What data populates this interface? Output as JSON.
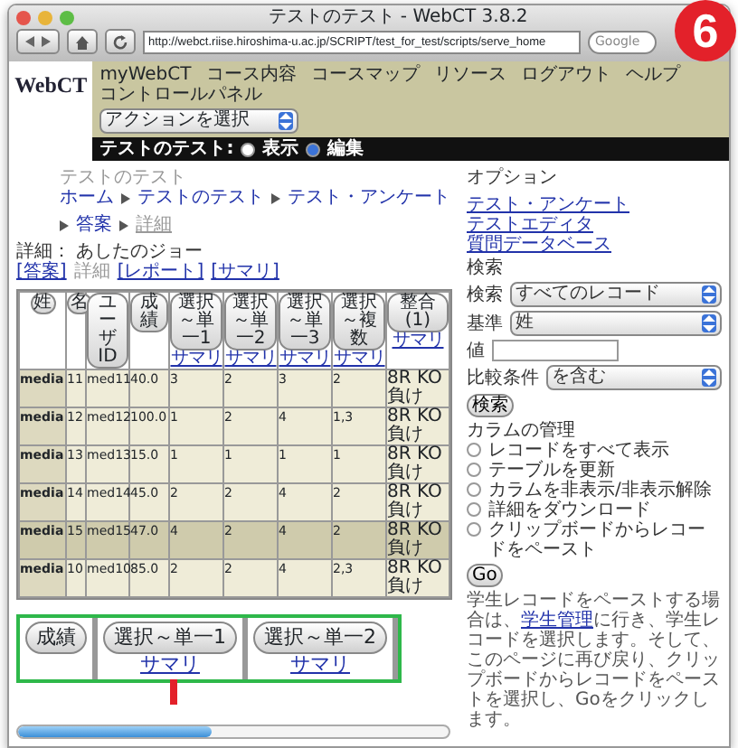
{
  "window": {
    "title": "テストのテスト - WebCT 3.8.2"
  },
  "toolbar": {
    "url": "http://webct.riise.hiroshima-u.ac.jp/SCRIPT/test_for_test/scripts/serve_home",
    "search": {
      "placeholder": "Google"
    }
  },
  "logo": "WebCT",
  "nav_links": [
    "myWebCT",
    "コース内容",
    "コースマップ",
    "リソース",
    "ログアウト",
    "ヘルプ",
    "コントロールパネル"
  ],
  "action_select": "アクションを選択",
  "mode_bar": {
    "label": "テストのテスト:",
    "options": [
      {
        "label": "表示",
        "selected": false
      },
      {
        "label": "編集",
        "selected": true
      }
    ]
  },
  "course_title": "テストのテスト",
  "breadcrumb": [
    {
      "label": "ホーム",
      "current": false
    },
    {
      "label": "テストのテスト",
      "current": false
    },
    {
      "label": "テスト・アンケート",
      "current": false
    },
    {
      "label": "答案",
      "current": false
    },
    {
      "label": "詳細",
      "current": true
    }
  ],
  "detail_heading": "詳細： あしたのジョー",
  "view_links": [
    {
      "label": "[答案]",
      "disabled": false
    },
    {
      "label": "詳細",
      "disabled": true
    },
    {
      "label": "[レポート]",
      "disabled": false
    },
    {
      "label": "[サマリ]",
      "disabled": false
    }
  ],
  "table": {
    "columns": [
      {
        "label": "姓"
      },
      {
        "label": "名"
      },
      {
        "label": "ユーザID"
      },
      {
        "label": "成績"
      },
      {
        "label": "選択～単一1",
        "link": "サマリ"
      },
      {
        "label": "選択～単一2",
        "link": "サマリ"
      },
      {
        "label": "選択～単一3",
        "link": "サマリ"
      },
      {
        "label": "選択～複数",
        "link": "サマリ"
      },
      {
        "label": "整合 (1)",
        "link": "サマリ"
      }
    ],
    "rows": [
      {
        "selected": false,
        "cells": [
          "media",
          "11",
          "med11",
          "40.0",
          "3",
          "2",
          "3",
          "2",
          "8R KO負け"
        ]
      },
      {
        "selected": false,
        "cells": [
          "media",
          "12",
          "med12",
          "100.0",
          "1",
          "2",
          "4",
          "1,3",
          "8R KO負け"
        ]
      },
      {
        "selected": false,
        "cells": [
          "media",
          "13",
          "med13",
          "15.0",
          "1",
          "1",
          "1",
          "1",
          "8R KO負け"
        ]
      },
      {
        "selected": false,
        "cells": [
          "media",
          "14",
          "med14",
          "45.0",
          "2",
          "2",
          "4",
          "2",
          "8R KO負け"
        ]
      },
      {
        "selected": true,
        "cells": [
          "media",
          "15",
          "med15",
          "47.0",
          "4",
          "2",
          "4",
          "2",
          "8R KO負け"
        ]
      },
      {
        "selected": false,
        "cells": [
          "media",
          "10",
          "med10",
          "85.0",
          "2",
          "2",
          "4",
          "2,3",
          "8R KO負け"
        ]
      }
    ]
  },
  "sidebar": {
    "heading": "オプション",
    "links": [
      "テスト・アンケート",
      "テストエディタ",
      "質問データベース"
    ],
    "search": {
      "heading": "検索",
      "fields": [
        {
          "kind": "select",
          "label": "検索",
          "value": "すべてのレコード"
        },
        {
          "kind": "select",
          "label": "基準",
          "value": "姓"
        },
        {
          "kind": "text",
          "label": "値"
        },
        {
          "kind": "select",
          "label": "比較条件",
          "value": "を含む"
        }
      ],
      "button": "検索"
    },
    "columns": {
      "heading": "カラムの管理",
      "options": [
        {
          "label": "レコードをすべて表示",
          "selected": false
        },
        {
          "label": "テーブルを更新",
          "selected": false
        },
        {
          "label": "カラムを非表示/非表示解除",
          "selected": false
        },
        {
          "label": "詳細をダウンロード",
          "selected": false
        },
        {
          "label": "クリップボードからレコードをペースト",
          "selected": false
        }
      ],
      "button": "Go"
    },
    "help": [
      "学生レコードをペーストする場合は、",
      {
        "link": "学生管理"
      },
      "に行き、学生レコードを選択します。そして、このページに再び戻り、クリップボードからレコードをペーストを選択し、Goをクリックします。"
    ]
  },
  "callout": {
    "columns": [
      {
        "label": "成績"
      },
      {
        "label": "選択～単一1",
        "link": "サマリ"
      },
      {
        "label": "選択～単一2",
        "link": "サマリ"
      }
    ]
  },
  "step_badge": "6"
}
